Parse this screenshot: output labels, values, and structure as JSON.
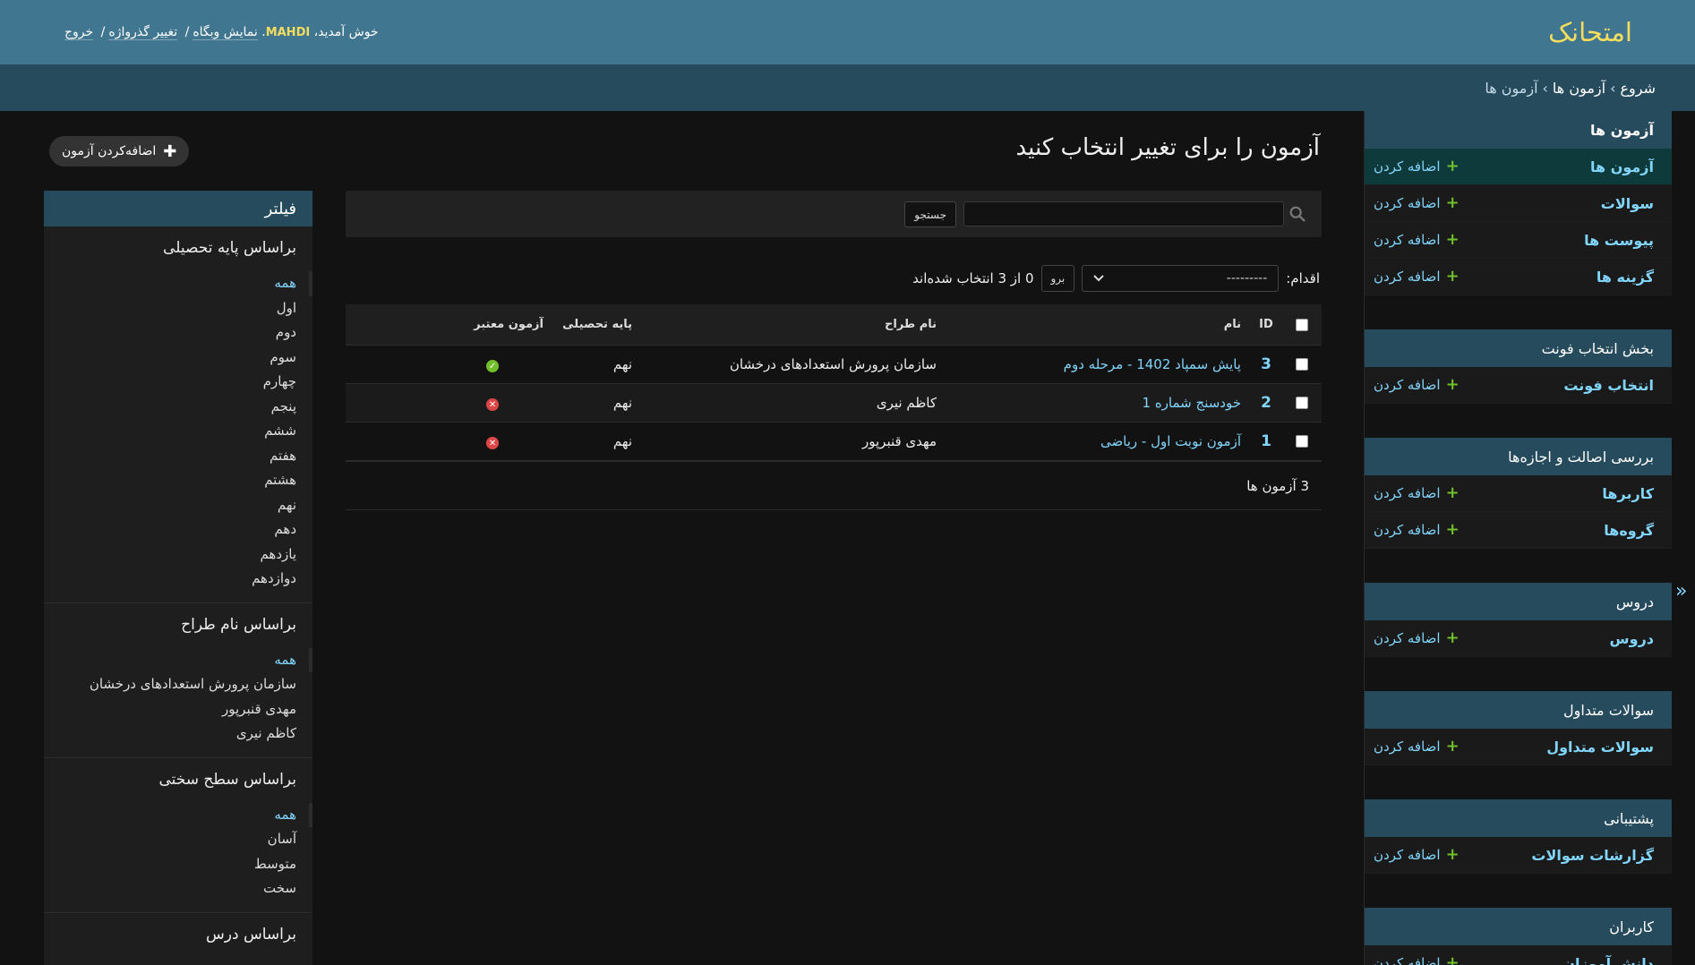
{
  "header": {
    "branding": "امتحانک",
    "welcome": "خوش آمدید،",
    "username": "MAHDI",
    "view_site": "نمایش وبگاه",
    "change_password": "تغییر گذرواژه",
    "logout": "خروج"
  },
  "breadcrumbs": {
    "home": "شروع",
    "app": "آزمون ها",
    "current": "آزمون ها"
  },
  "nav": {
    "add_label": "اضافه کردن",
    "modules": [
      {
        "caption": "آزمون ها",
        "bold": true,
        "models": [
          "آزمون ها",
          "سوالات",
          "پیوست ها",
          "گزینه ها"
        ]
      },
      {
        "caption": "بخش انتخاب فونت",
        "models": [
          "انتخاب فونت"
        ]
      },
      {
        "caption": "بررسی اصالت و اجازه‌ها",
        "models": [
          "کاربرها",
          "گروه‌ها"
        ]
      },
      {
        "caption": "دروس",
        "models": [
          "دروس"
        ]
      },
      {
        "caption": "سوالات متداول",
        "models": [
          "سوالات متداول"
        ]
      },
      {
        "caption": "پشتیبانی",
        "models": [
          "گزارشات سوالات"
        ]
      },
      {
        "caption": "کاربران",
        "models": [
          "دانش آموزان"
        ]
      }
    ],
    "toggle": "«"
  },
  "content": {
    "title": "آزمون را برای تغییر انتخاب کنید",
    "add_button": "اضافه‌کردن آزمون",
    "search_button": "جستجو",
    "action_label": "اقدام:",
    "action_value": "---------",
    "go_button": "برو",
    "selection_counter": "0 از 3 انتخاب شده‌اند",
    "paginator": "3 آزمون ها"
  },
  "table": {
    "headers": {
      "id": "ID",
      "name": "نام",
      "designer": "نام طراح",
      "grade": "پایه تحصیلی",
      "valid": "آزمون معتبر"
    },
    "rows": [
      {
        "id": "3",
        "name": "پایش سمپاد 1402 - مرحله دوم",
        "designer": "سازمان پرورش استعدادهای درخشان",
        "grade": "نهم",
        "valid": true
      },
      {
        "id": "2",
        "name": "خودسنج شماره 1",
        "designer": "کاظم نیری",
        "grade": "نهم",
        "valid": false
      },
      {
        "id": "1",
        "name": "آزمون نوبت اول - ریاضی",
        "designer": "مهدی قنبرپور",
        "grade": "نهم",
        "valid": false
      }
    ]
  },
  "filter": {
    "title": "فیلتر",
    "groups": [
      {
        "title": "براساس پایه تحصیلی",
        "items": [
          "همه",
          "اول",
          "دوم",
          "سوم",
          "چهارم",
          "پنجم",
          "ششم",
          "هفتم",
          "هشتم",
          "نهم",
          "دهم",
          "یازدهم",
          "دوازدهم"
        ]
      },
      {
        "title": "براساس نام طراح",
        "items": [
          "همه",
          "سازمان پرورش استعدادهای درخشان",
          "مهدی قنبرپور",
          "کاظم نیری"
        ]
      },
      {
        "title": "براساس سطح سختی",
        "items": [
          "همه",
          "آسان",
          "متوسط",
          "سخت"
        ]
      },
      {
        "title": "براساس درس",
        "items": []
      }
    ]
  },
  "colors": {
    "header": "#417690",
    "breadcrumbs": "#264b5d",
    "branding": "#f5dd5d",
    "link": "#81d4fa",
    "add_plus": "#70bf2b",
    "valid_yes": "#70bf2b",
    "valid_no": "#dd4646"
  }
}
